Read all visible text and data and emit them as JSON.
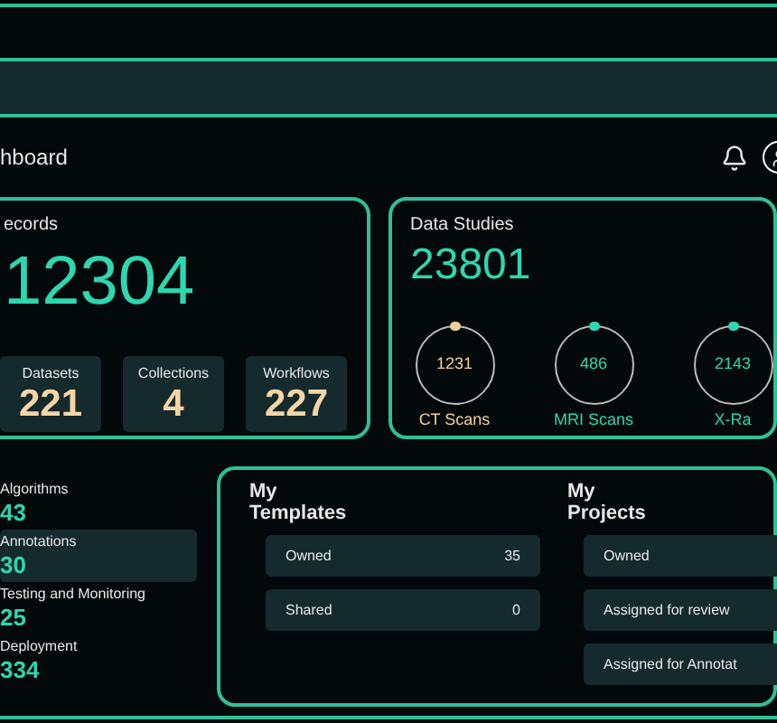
{
  "header": {
    "title": "hboard"
  },
  "records": {
    "title": "ecords",
    "value": "12304",
    "stats": [
      {
        "label": "Datasets",
        "value": "221"
      },
      {
        "label": "Collections",
        "value": "4"
      },
      {
        "label": "Workflows",
        "value": "227"
      }
    ]
  },
  "data_studies": {
    "title": "Data Studies",
    "value": "23801",
    "scans": [
      {
        "value": "1231",
        "label": "CT Scans",
        "color": "#f2cf98"
      },
      {
        "value": "486",
        "label": "MRI Scans",
        "color": "#2fd6b0"
      },
      {
        "value": "2143",
        "label": "X-Ra",
        "color": "#2fd6b0"
      }
    ]
  },
  "sidebar": {
    "items": [
      {
        "label": "Algorithms",
        "count": "43",
        "selected": false
      },
      {
        "label": "Annotations",
        "count": "30",
        "selected": true
      },
      {
        "label": "Testing and Monitoring",
        "count": "25",
        "selected": false
      },
      {
        "label": "Deployment",
        "count": "334",
        "selected": false
      }
    ]
  },
  "templates": {
    "title": "My Templates",
    "rows": [
      {
        "label": "Owned",
        "count": "35"
      },
      {
        "label": "Shared",
        "count": "0"
      }
    ]
  },
  "projects": {
    "title": "My Projects",
    "rows": [
      {
        "label": "Owned"
      },
      {
        "label": "Assigned for review"
      },
      {
        "label": "Assigned for Annotat"
      }
    ]
  }
}
